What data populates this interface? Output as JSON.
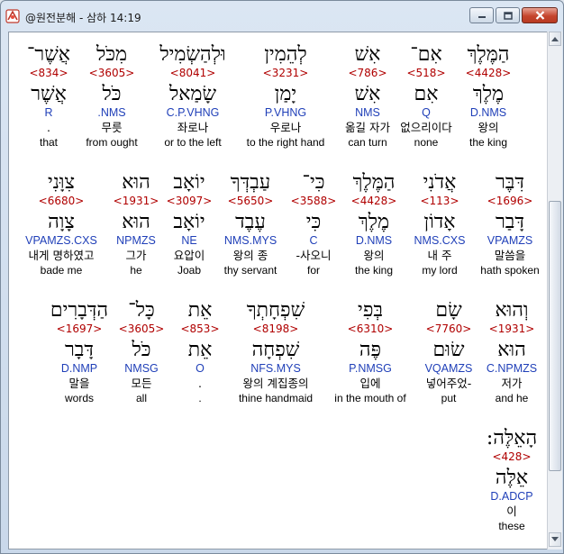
{
  "window": {
    "title": "@원전분해 - 삼하 14:19"
  },
  "rows": [
    {
      "words": [
        {
          "heb": "הַמֶּלֶךְ",
          "strong": "<4428>",
          "lemma": "מֶלֶךְ",
          "morph": "D.NMS",
          "kor": "왕의",
          "eng": "the king"
        },
        {
          "heb": "אִם־",
          "strong": "<518>",
          "lemma": "אִם",
          "morph": "Q",
          "kor": "없으리이다",
          "eng": "none"
        },
        {
          "heb": "אִשׁ",
          "strong": "<786>",
          "lemma": "אִשׁ",
          "morph": "NMS",
          "kor": "옮길 자가",
          "eng": "can turn"
        },
        {
          "heb": "לְהֵמִין",
          "strong": "<3231>",
          "lemma": "יָמַן",
          "morph": "P.VHNG",
          "kor": "우로나",
          "eng": "to the right hand"
        },
        {
          "heb": "וּלְהַשְׂמִיל",
          "strong": "<8041>",
          "lemma": "שָׂמַאל",
          "morph": "C.P.VHNG",
          "kor": "좌로나",
          "eng": "or to the left"
        },
        {
          "heb": "מִכֹּל",
          "strong": "<3605>",
          "lemma": "כֹּל",
          "morph": ".NMS",
          "kor": "무릇",
          "eng": "from ought"
        },
        {
          "heb": "אֲשֶׁר־",
          "strong": "<834>",
          "lemma": "אֲשֶׁר",
          "morph": "R",
          "kor": ".",
          "eng": "that"
        }
      ]
    },
    {
      "words": [
        {
          "heb": "דִּבֶּר",
          "strong": "<1696>",
          "lemma": "דָּבַר",
          "morph": "VPAMZS",
          "kor": "말씀을",
          "eng": "hath spoken"
        },
        {
          "heb": "אֲדֹנִי",
          "strong": "<113>",
          "lemma": "אָדוֹן",
          "morph": "NMS.CXS",
          "kor": "내 주",
          "eng": "my lord"
        },
        {
          "heb": "הַמֶּלֶךְ",
          "strong": "<4428>",
          "lemma": "מֶלֶךְ",
          "morph": "D.NMS",
          "kor": "왕의",
          "eng": "the king"
        },
        {
          "heb": "כִּי־",
          "strong": "<3588>",
          "lemma": "כִּי",
          "morph": "C",
          "kor": "-사오니",
          "eng": "for"
        },
        {
          "heb": "עַבְדְּךָ",
          "strong": "<5650>",
          "lemma": "עֶבֶד",
          "morph": "NMS.MYS",
          "kor": "왕의 종",
          "eng": "thy servant"
        },
        {
          "heb": "יוֹאָב",
          "strong": "<3097>",
          "lemma": "יוֹאָב",
          "morph": "NE",
          "kor": "요압이",
          "eng": "Joab"
        },
        {
          "heb": "הוּא",
          "strong": "<1931>",
          "lemma": "הוּא",
          "morph": "NPMZS",
          "kor": "그가",
          "eng": "he"
        },
        {
          "heb": "צִוָּנִי",
          "strong": "<6680>",
          "lemma": "צָוָה",
          "morph": "VPAMZS.CXS",
          "kor": "내게 명하였고",
          "eng": "bade me"
        }
      ]
    },
    {
      "words": [
        {
          "heb": "וְהוּא",
          "strong": "<1931>",
          "lemma": "הוּא",
          "morph": "C.NPMZS",
          "kor": "저가",
          "eng": "and he"
        },
        {
          "heb": "שָׂם",
          "strong": "<7760>",
          "lemma": "שׂוּם",
          "morph": "VQAMZS",
          "kor": "넣어주었-",
          "eng": "put"
        },
        {
          "heb": "בְּפִי",
          "strong": "<6310>",
          "lemma": "פֶּה",
          "morph": "P.NMSG",
          "kor": "입에",
          "eng": "in the mouth of"
        },
        {
          "heb": "שִׁפְחָתְךָ",
          "strong": "<8198>",
          "lemma": "שִׁפְחָה",
          "morph": "NFS.MYS",
          "kor": "왕의 계집종의",
          "eng": "thine handmaid"
        },
        {
          "heb": "אֵת",
          "strong": "<853>",
          "lemma": "אֵת",
          "morph": "O",
          "kor": ".",
          "eng": "."
        },
        {
          "heb": "כָּל־",
          "strong": "<3605>",
          "lemma": "כֹּל",
          "morph": "NMSG",
          "kor": "모든",
          "eng": "all"
        },
        {
          "heb": "הַדְּבָרִים",
          "strong": "<1697>",
          "lemma": "דָּבָר",
          "morph": "D.NMP",
          "kor": "말을",
          "eng": "words"
        }
      ]
    },
    {
      "words": [
        {
          "heb": "הָאֵלֶּה:",
          "strong": "<428>",
          "lemma": "אֵלֶּה",
          "morph": "D.ADCP",
          "kor": "이",
          "eng": "these"
        }
      ]
    }
  ]
}
